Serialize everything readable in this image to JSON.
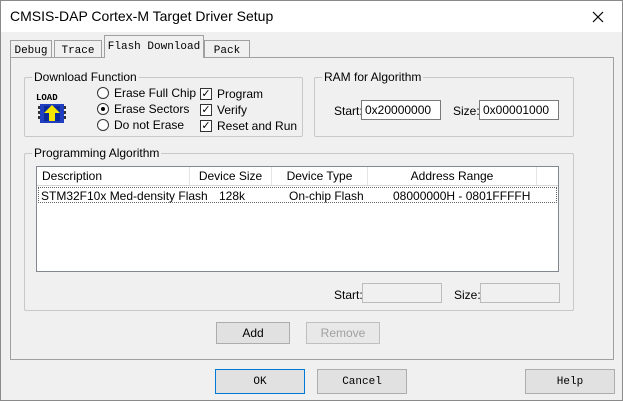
{
  "window": {
    "title": "CMSIS-DAP Cortex-M Target Driver Setup",
    "close_glyph": "✕"
  },
  "tabs": [
    {
      "label": "Debug",
      "active": false
    },
    {
      "label": "Trace",
      "active": false
    },
    {
      "label": "Flash Download",
      "active": true
    },
    {
      "label": "Pack",
      "active": false
    }
  ],
  "download_function": {
    "title": "Download Function",
    "icon": "load-flash-icon",
    "icon_text": "LOAD",
    "radios": [
      {
        "label": "Erase Full Chip",
        "selected": false
      },
      {
        "label": "Erase Sectors",
        "selected": true
      },
      {
        "label": "Do not Erase",
        "selected": false
      }
    ],
    "checks": [
      {
        "label": "Program",
        "checked": true
      },
      {
        "label": "Verify",
        "checked": true
      },
      {
        "label": "Reset and Run",
        "checked": true
      }
    ],
    "check_glyph": "✓"
  },
  "ram": {
    "title": "RAM for Algorithm",
    "start_label": "Start:",
    "start_value": "0x20000000",
    "size_label": "Size:",
    "size_value": "0x00001000"
  },
  "programming": {
    "title": "Programming Algorithm",
    "columns": [
      "Description",
      "Device Size",
      "Device Type",
      "Address Range"
    ],
    "rows": [
      [
        "STM32F10x Med-density Flash",
        "128k",
        "On-chip Flash",
        "08000000H - 0801FFFFH"
      ]
    ],
    "start_label": "Start:",
    "start_value": "",
    "size_label": "Size:",
    "size_value": "",
    "add_label": "Add",
    "remove_label": "Remove"
  },
  "footer": {
    "ok_label": "OK",
    "cancel_label": "Cancel",
    "help_label": "Help"
  },
  "colors": {
    "accent": "#0078d7",
    "window_bg": "#f0f0f0"
  }
}
